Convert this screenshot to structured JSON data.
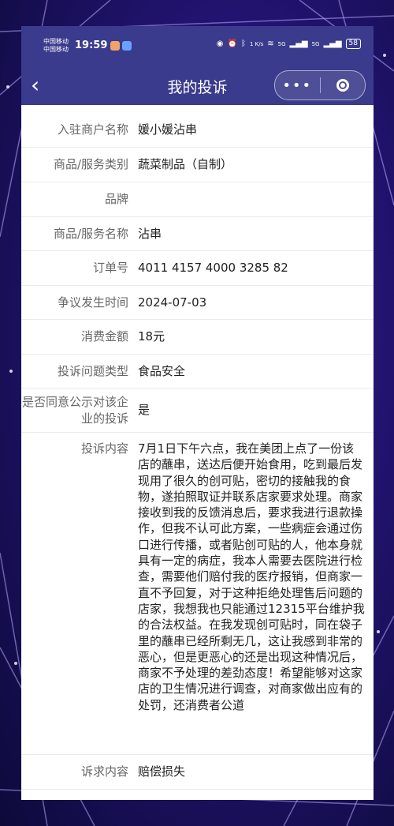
{
  "status_bar": {
    "carrier1": "中国移动",
    "carrier2": "中国移动",
    "time": "19:59",
    "net_speed": "1 K/s",
    "signal1": "5G",
    "signal2": "5G",
    "battery": "58"
  },
  "nav": {
    "back_glyph": "‹",
    "title": "我的投诉",
    "more_glyph": "•••"
  },
  "fields": [
    {
      "label": "入驻商户名称",
      "value": "媛小媛沾串"
    },
    {
      "label": "商品/服务类别",
      "value": "蔬菜制品（自制）"
    },
    {
      "label": "品牌",
      "value": ""
    },
    {
      "label": "商品/服务名称",
      "value": "沾串"
    },
    {
      "label": "订单号",
      "value": "4011 4157 4000 3285 82"
    },
    {
      "label": "争议发生时间",
      "value": "2024-07-03"
    },
    {
      "label": "消费金额",
      "value": "18元"
    },
    {
      "label": "投诉问题类型",
      "value": "食品安全"
    },
    {
      "label": "是否同意公示对该企业的投诉",
      "value": "是"
    }
  ],
  "complaint": {
    "label": "投诉内容",
    "value": "7月1日下午六点，我在美团上点了一份该店的蘸串，送达后便开始食用，吃到最后发现用了很久的创可贴，密切的接触我的食物，遂拍照取证并联系店家要求处理。商家接收到我的反馈消息后，要求我进行退款操作，但我不认可此方案，一些病症会通过伤口进行传播，或者贴创可贴的人，他本身就具有一定的病症，我本人需要去医院进行检查，需要他们赔付我的医疗报销，但商家一直不予回复，对于这种拒绝处理售后问题的店家，我想我也只能通过12315平台维护我的合法权益。在我发现创可贴时，同在袋子里的蘸串已经所剩无几，这让我感到非常的恶心，但是更恶心的还是出现这种情况后，商家不予处理的差劲态度！希望能够对这家店的卫生情况进行调查，对商家做出应有的处罚，还消费者公道"
  },
  "appeal": {
    "label": "诉求内容",
    "value": "赔偿损失"
  }
}
